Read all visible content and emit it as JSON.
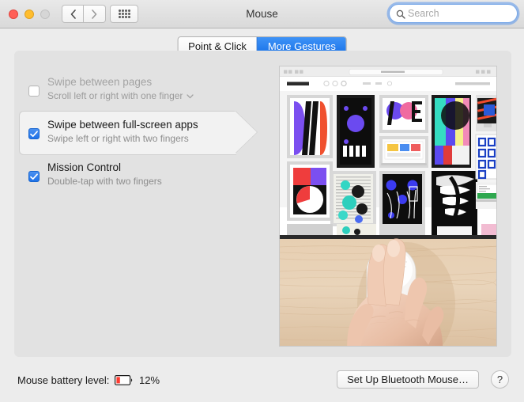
{
  "window": {
    "title": "Mouse",
    "traffic_lights": [
      "close",
      "minimize",
      "zoom"
    ],
    "nav_back_icon": "chevron-left-icon",
    "nav_forward_icon": "chevron-right-icon",
    "show_all_icon": "grid-icon"
  },
  "search": {
    "placeholder": "Search",
    "value": "",
    "icon": "search-icon",
    "focused": true
  },
  "tabs": [
    {
      "label": "Point & Click",
      "active": false
    },
    {
      "label": "More Gestures",
      "active": true
    }
  ],
  "gestures": [
    {
      "title": "Swipe between pages",
      "subtitle": "Scroll left or right with one finger",
      "checked": false,
      "enabled": false,
      "selected": false,
      "has_popup": true,
      "popup_icon": "chevron-down-icon"
    },
    {
      "title": "Swipe between full-screen apps",
      "subtitle": "Swipe left or right with two fingers",
      "checked": true,
      "enabled": true,
      "selected": true,
      "has_popup": false
    },
    {
      "title": "Mission Control",
      "subtitle": "Double-tap with two fingers",
      "checked": true,
      "enabled": true,
      "selected": false,
      "has_popup": false
    }
  ],
  "preview": {
    "description": "Demonstration video of a hand using two fingers on a white Magic Mouse on a wooden desk, above a web browser window showing a colorful design poster gallery"
  },
  "status": {
    "battery_label": "Mouse battery level:",
    "battery_percent": "12%",
    "battery_level": 12,
    "battery_icon": "battery-low-icon",
    "battery_color": "#ff3b30"
  },
  "actions": {
    "setup_bluetooth_mouse": "Set Up Bluetooth Mouse…",
    "help": "?",
    "help_icon": "question-mark-icon"
  },
  "colors": {
    "accent": "#1f72e8",
    "tab_active": "#2a83f0",
    "battery_red": "#ff3b30",
    "window_bg": "#ececec",
    "panel_bg": "#e2e2e2"
  }
}
